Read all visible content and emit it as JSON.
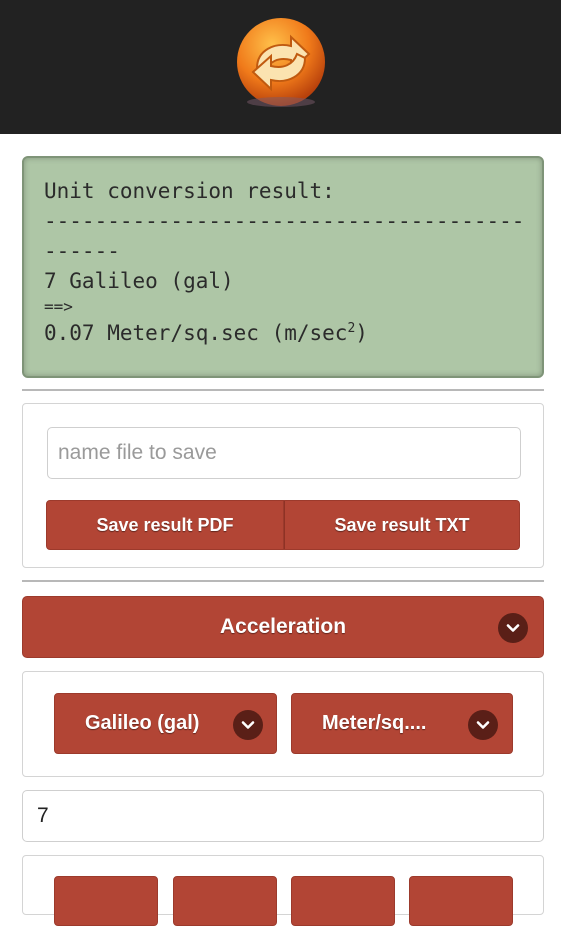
{
  "header": {
    "logo_icon": "refresh-arrows-icon",
    "background": "#222222"
  },
  "result": {
    "title": "Unit conversion result:",
    "separator_line1": "---------------------------------------",
    "separator_line2": "------",
    "input_line": "7 Galileo (gal)",
    "arrow": "==>",
    "output_text": "0.07 Meter/sq.sec (m/sec",
    "output_superscript": "2",
    "output_close": ")"
  },
  "save": {
    "filename_placeholder": "name file to save",
    "filename_value": "",
    "pdf_label": "Save result PDF",
    "txt_label": "Save result TXT"
  },
  "category": {
    "selected": "Acceleration"
  },
  "units": {
    "from": "Galileo (gal)",
    "to": "Meter/sq...."
  },
  "value_input": {
    "value": "7"
  },
  "keypad": {
    "keys": [
      "",
      "",
      "",
      ""
    ]
  },
  "colors": {
    "accent": "#b24535",
    "result_panel": "#aec6a6",
    "chevron_bg": "#5a1f17"
  }
}
